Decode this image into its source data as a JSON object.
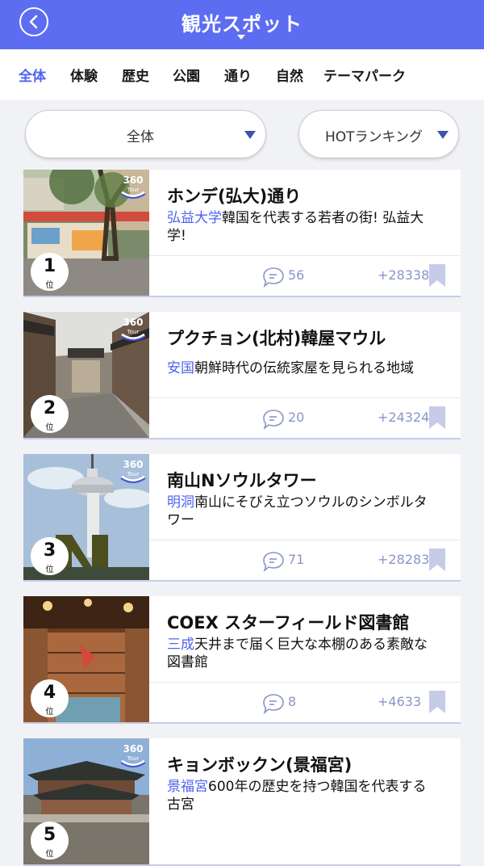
{
  "header": {
    "title": "観光スポット"
  },
  "tabs": [
    {
      "label": "全体",
      "active": true
    },
    {
      "label": "体験"
    },
    {
      "label": "歴史"
    },
    {
      "label": "公園"
    },
    {
      "label": "通り"
    },
    {
      "label": "自然"
    },
    {
      "label": "テーマパーク"
    }
  ],
  "filters": {
    "area": "全体",
    "sort": "HOTランキング"
  },
  "spots": [
    {
      "rank": "1",
      "rank_unit": "位",
      "name": "ホンデ(弘大)通り",
      "area": "弘益大学",
      "description": "韓国を代表する若者の街! 弘益大学!",
      "comments": "56",
      "score": "+28338"
    },
    {
      "rank": "2",
      "rank_unit": "位",
      "name": "プクチョン(北村)韓屋マウル",
      "area": "安国",
      "description": "朝鮮時代の伝統家屋を見られる地域",
      "comments": "20",
      "score": "+24324"
    },
    {
      "rank": "3",
      "rank_unit": "位",
      "name": "南山Nソウルタワー",
      "area": "明洞",
      "description": "南山にそびえ立つソウルのシンボルタワー",
      "comments": "71",
      "score": "+28283"
    },
    {
      "rank": "4",
      "rank_unit": "位",
      "name": "COEX スターフィールド図書館",
      "area": "三成",
      "description": "天井まで届く巨大な本棚のある素敵な図書館",
      "comments": "8",
      "score": "+4633"
    },
    {
      "rank": "5",
      "rank_unit": "位",
      "name": "キョンボックン(景福宮)",
      "area": "景福宮",
      "description": "600年の歴史を持つ韓国を代表する古宮",
      "comments": "",
      "score": ""
    }
  ],
  "tour_badge": {
    "line1": "360",
    "line2": "Tour"
  },
  "colors": {
    "accent": "#5c6df2",
    "link": "#4e62f0",
    "meta": "#8b95c9"
  },
  "icons": {
    "back": "chevron-left-icon",
    "comment": "comment-bubble-icon",
    "bookmark": "bookmark-icon",
    "tour": "360-tour-icon"
  }
}
